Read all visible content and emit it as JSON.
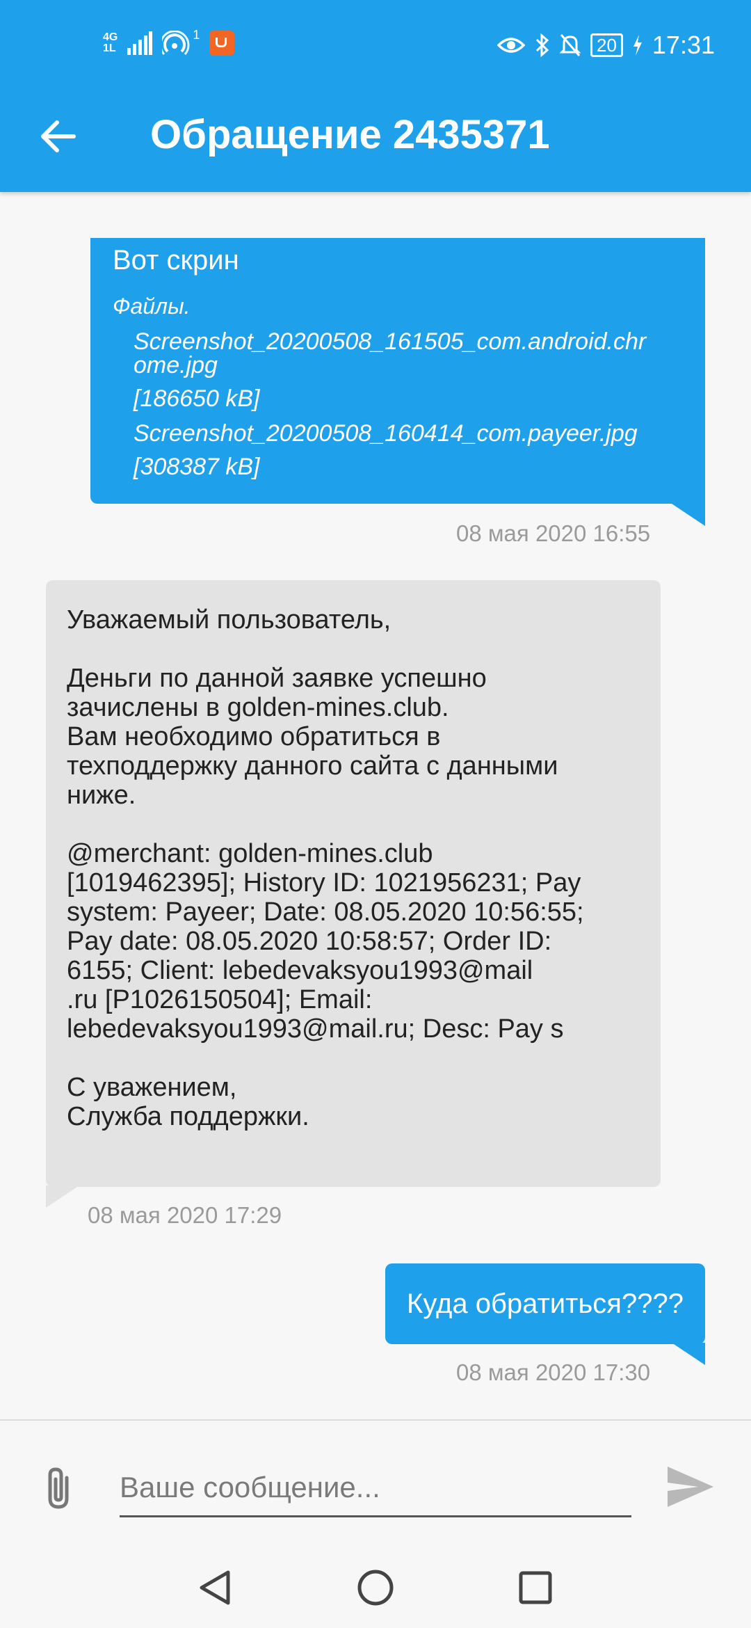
{
  "status_bar": {
    "network_top": "4G",
    "network_bottom": "1L",
    "hotspot_badge": "1",
    "battery": "20",
    "time": "17:31"
  },
  "header": {
    "title": "Обращение 2435371"
  },
  "messages": [
    {
      "text": "Вот скрин",
      "files_label": "Файлы.",
      "files": [
        "Screenshot_20200508_161505_com.android.chr",
        "ome.jpg",
        "[186650 kB]",
        "Screenshot_20200508_160414_com.payeer.jpg",
        "[308387 kB]"
      ],
      "timestamp": "08 мая 2020 16:55"
    },
    {
      "text": "Уважаемый пользователь,\n\nДеньги по данной заявке успешно\nзачислены в golden-mines.club.\nВам необходимо обратиться в\nтехподдержку данного сайта с данными\nниже.\n\n@merchant: golden-mines.club\n[1019462395]; History ID: 1021956231; Pay\nsystem: Payeer; Date: 08.05.2020 10:56:55;\nPay date: 08.05.2020 10:58:57; Order ID:\n6155; Client: lebedevaksyou1993@mail\n.ru [P1026150504]; Email:\nlebedevaksyou1993@mail.ru; Desc: Pay s\n\nС уважением,\nСлужба поддержки.",
      "timestamp": "08 мая 2020 17:29"
    },
    {
      "text": "Куда обратиться????",
      "timestamp": "08 мая 2020 17:30"
    }
  ],
  "composer": {
    "placeholder": "Ваше сообщение..."
  },
  "colors": {
    "accent": "#1ea1ea",
    "incoming_bubble": "#e3e3e3",
    "timestamp": "#9a9a9a"
  },
  "icons": [
    "back-arrow-icon",
    "paperclip-icon",
    "send-icon",
    "nav-back-icon",
    "nav-home-icon",
    "nav-recents-icon"
  ]
}
